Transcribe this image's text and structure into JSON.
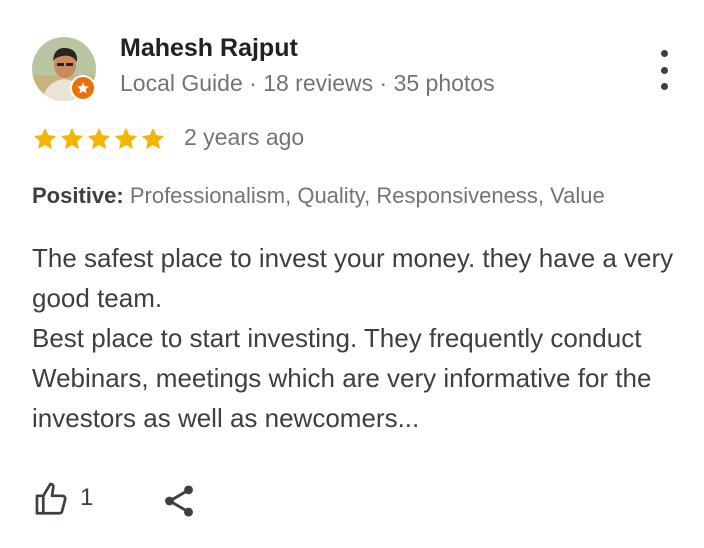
{
  "reviewer": {
    "name": "Mahesh Rajput",
    "meta": "Local Guide · 18 reviews · 35 photos"
  },
  "rating": {
    "stars": 5,
    "max": 5,
    "star_color": "#f5b400"
  },
  "time_ago": "2 years ago",
  "attributes": {
    "label": "Positive:",
    "values": "Professionalism, Quality, Responsiveness, Value"
  },
  "review_text": {
    "paragraph1": "The safest place to invest your money. they have a very good team.",
    "paragraph2": "Best place to start investing. They frequently conduct Webinars, meetings which are very informative for the investors as well as newcomers..."
  },
  "actions": {
    "like_icon": "thumbs-up-icon",
    "like_count": "1",
    "share_icon": "share-icon",
    "menu_icon": "more-vert-icon"
  },
  "colors": {
    "badge": "#e8710a",
    "muted": "#70757a",
    "text": "#3c4043"
  }
}
